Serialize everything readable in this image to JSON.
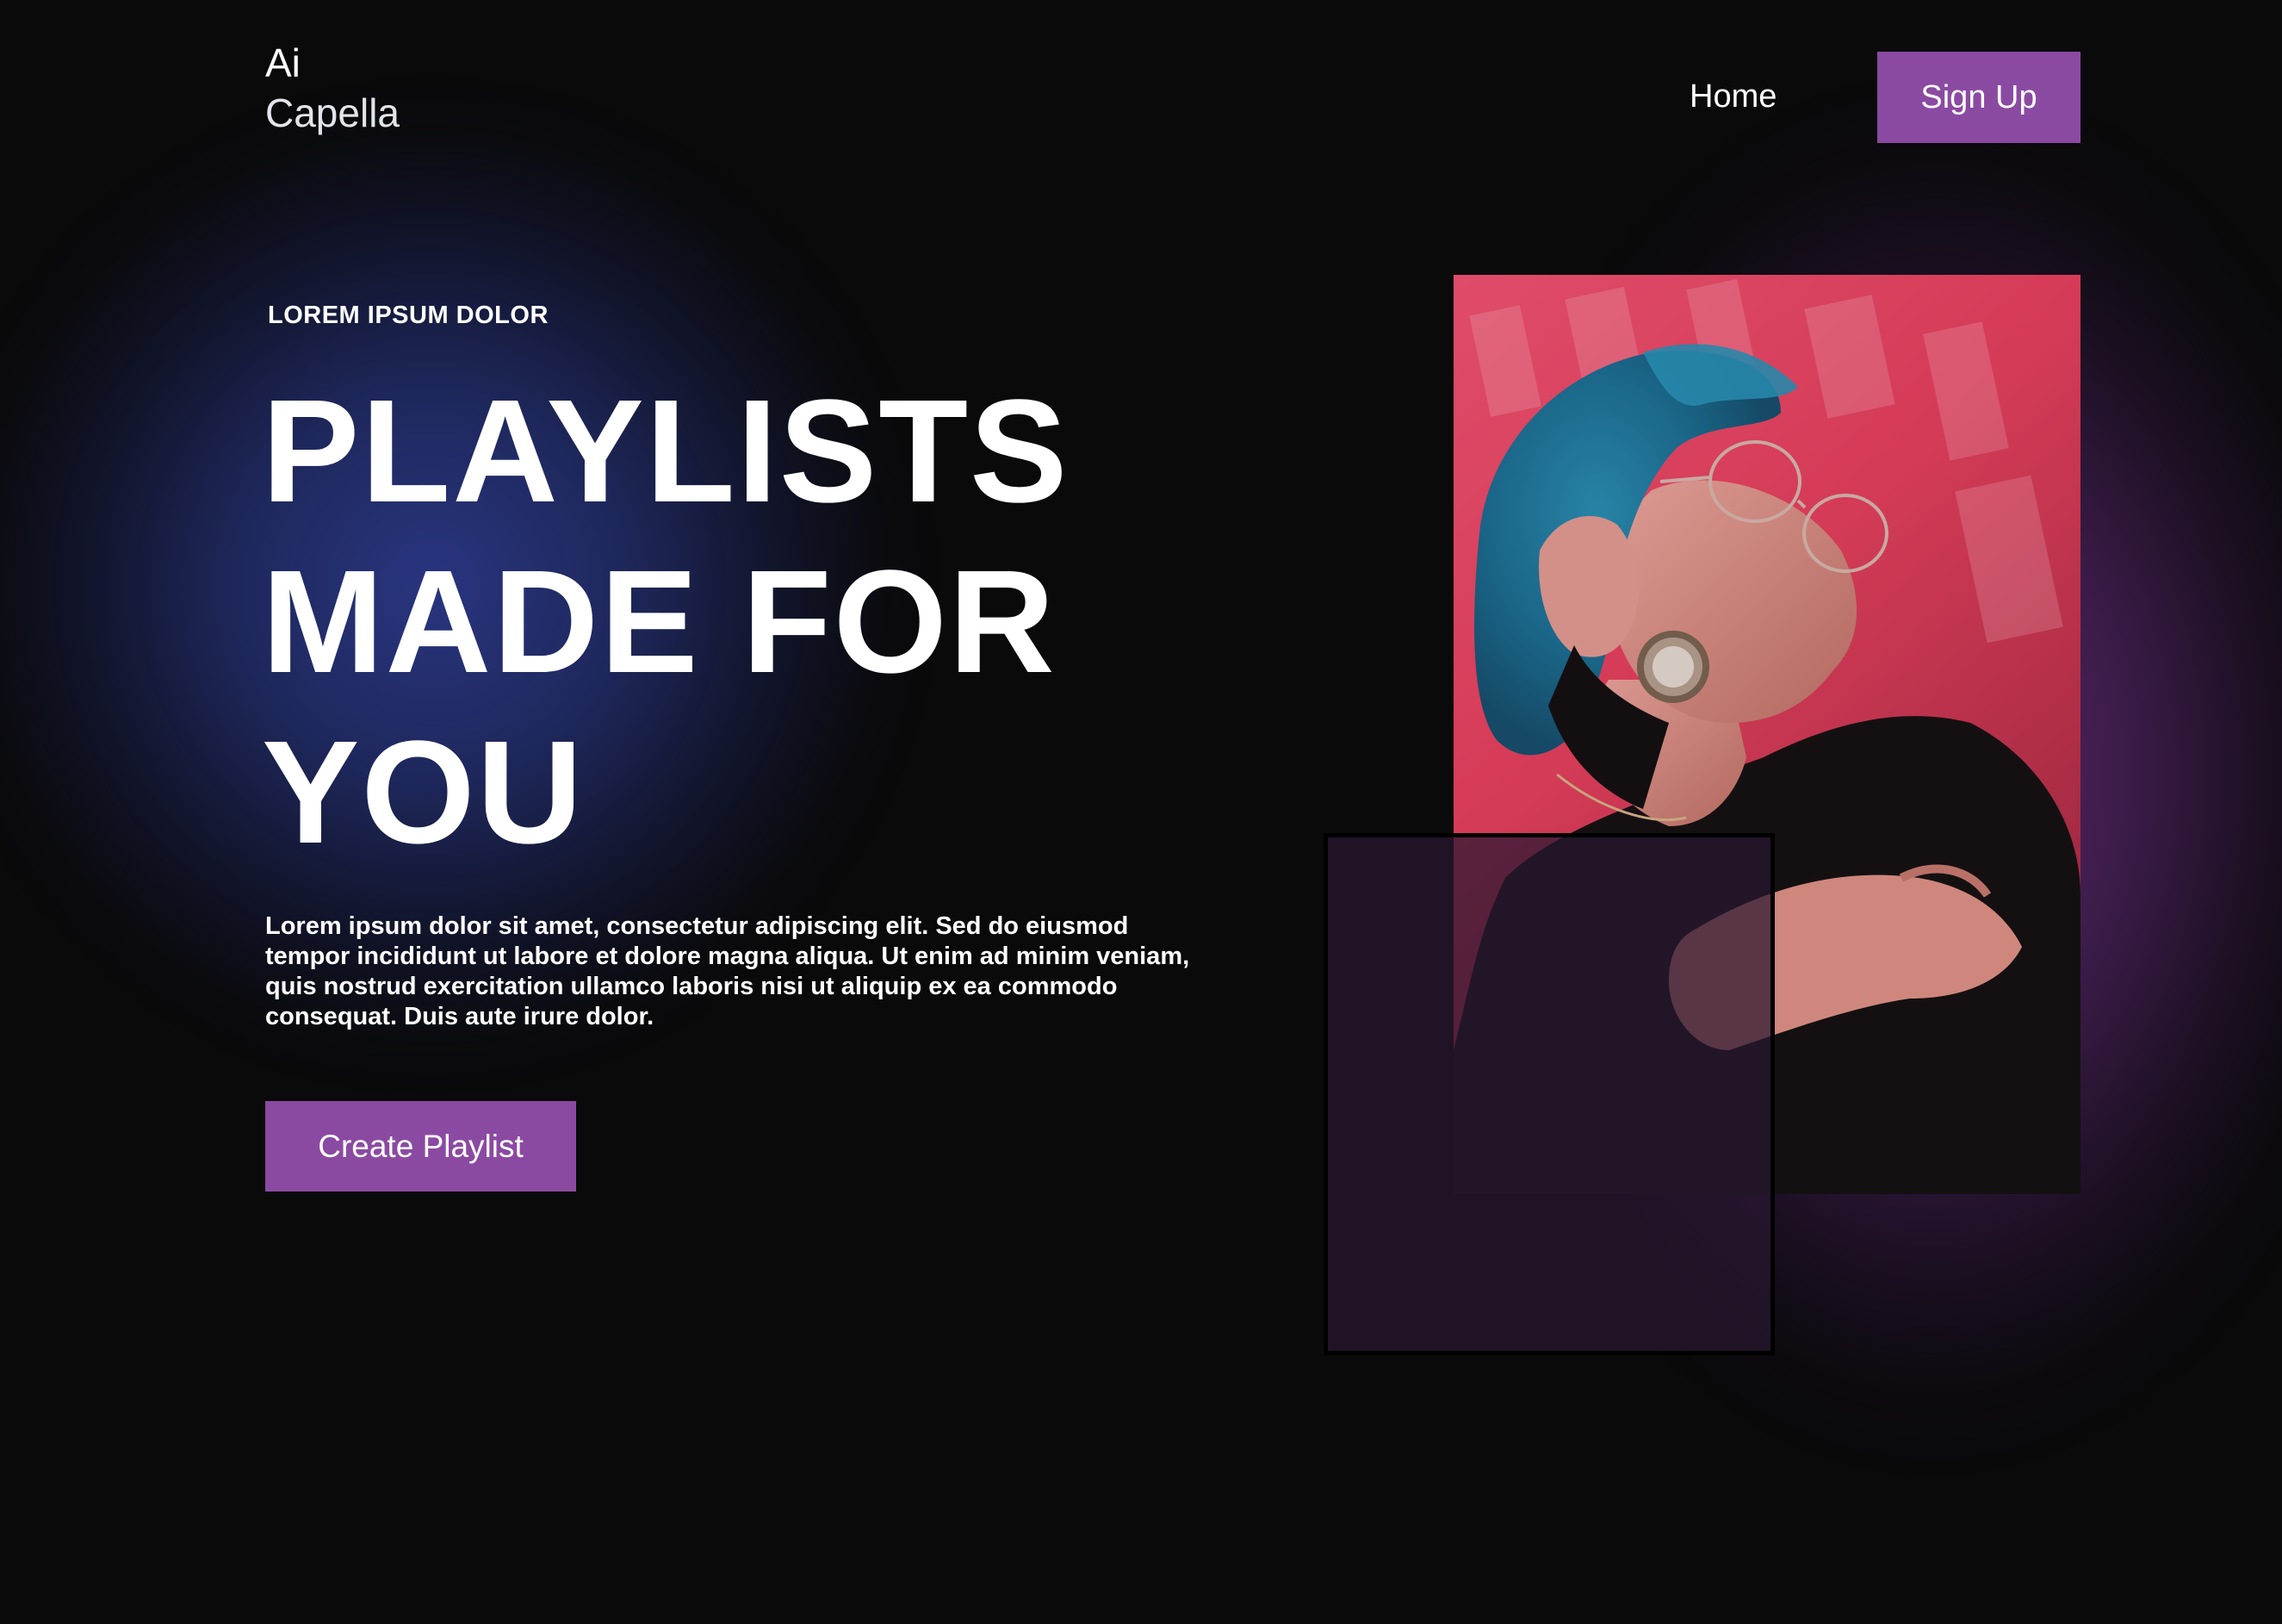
{
  "header": {
    "logo_line1": "Ai",
    "logo_line2": "Capella",
    "nav_home": "Home",
    "signup_label": "Sign Up"
  },
  "hero": {
    "eyebrow": "LOREM IPSUM DOLOR",
    "headline_line1": "PLAYLISTS",
    "headline_line2": "MADE FOR",
    "headline_line3": "YOU",
    "body": "Lorem ipsum dolor sit amet, consectetur adipiscing elit. Sed do eiusmod tempor incididunt ut labore et dolore magna aliqua. Ut enim ad minim veniam, quis nostrud exercitation ullamco laboris nisi ut aliquip ex ea commodo consequat. Duis aute irure dolor.",
    "cta_label": "Create Playlist"
  },
  "colors": {
    "background": "#0a0a0b",
    "accent": "#8b4aa2",
    "glow_blue": "#2b3887",
    "glow_purple": "#682c7e",
    "photo_pink": "#e63c63"
  },
  "icons": {
    "photo": "woman-with-blue-hair-photo"
  }
}
